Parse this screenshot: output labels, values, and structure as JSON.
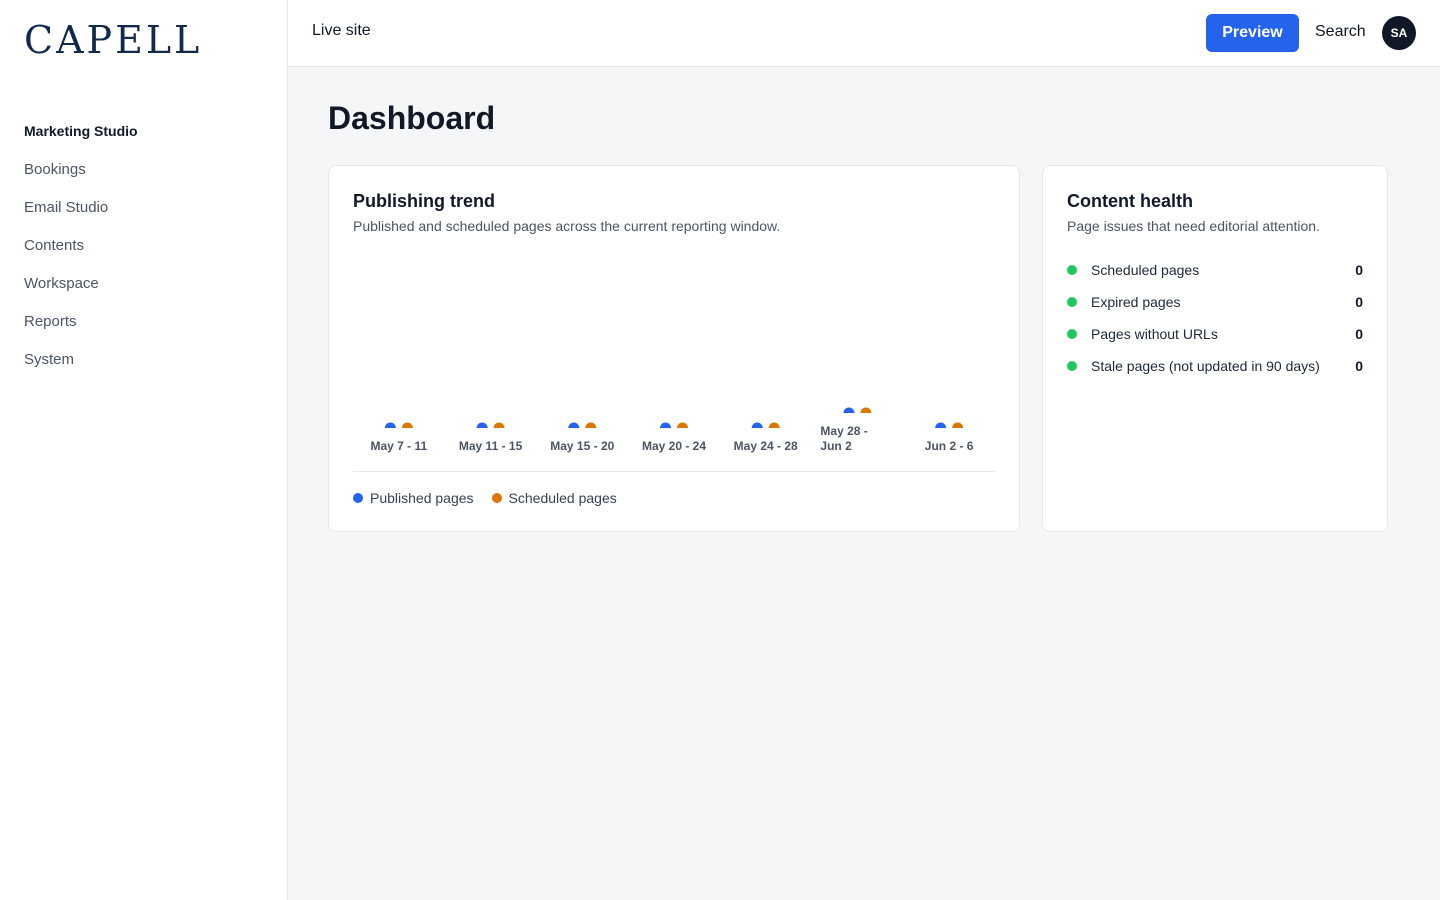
{
  "app": {
    "logo": "CAPELL"
  },
  "sidebar": {
    "items": [
      {
        "label": "Marketing Studio"
      },
      {
        "label": "Bookings"
      },
      {
        "label": "Email Studio"
      },
      {
        "label": "Contents"
      },
      {
        "label": "Workspace"
      },
      {
        "label": "Reports"
      },
      {
        "label": "System"
      }
    ]
  },
  "topbar": {
    "live_site": "Live site",
    "preview": "Preview",
    "search": "Search",
    "avatar_initials": "SA"
  },
  "page": {
    "title": "Dashboard"
  },
  "trend_card": {
    "title": "Publishing trend",
    "subtitle": "Published and scheduled pages across the current reporting window.",
    "legend": [
      "Published pages",
      "Scheduled pages"
    ]
  },
  "chart_data": {
    "type": "bar",
    "categories": [
      "May 7 - 11",
      "May 11 - 15",
      "May 15 - 20",
      "May 20 - 24",
      "May 24 - 28",
      "May 28 - Jun 2",
      "Jun 2 - 6"
    ],
    "series": [
      {
        "name": "Published pages",
        "color": "#2563eb",
        "values": [
          0,
          0,
          0,
          0,
          0,
          0,
          0
        ]
      },
      {
        "name": "Scheduled pages",
        "color": "#d97706",
        "values": [
          0,
          0,
          0,
          0,
          0,
          0,
          0
        ]
      }
    ],
    "legend_position": "bottom-left"
  },
  "health_card": {
    "title": "Content health",
    "subtitle": "Page issues that need editorial attention.",
    "status_color": "#22c55e",
    "items": [
      {
        "label": "Scheduled pages",
        "count": "0"
      },
      {
        "label": "Expired pages",
        "count": "0"
      },
      {
        "label": "Pages without URLs",
        "count": "0"
      },
      {
        "label": "Stale pages (not updated in 90 days)",
        "count": "0"
      }
    ]
  }
}
